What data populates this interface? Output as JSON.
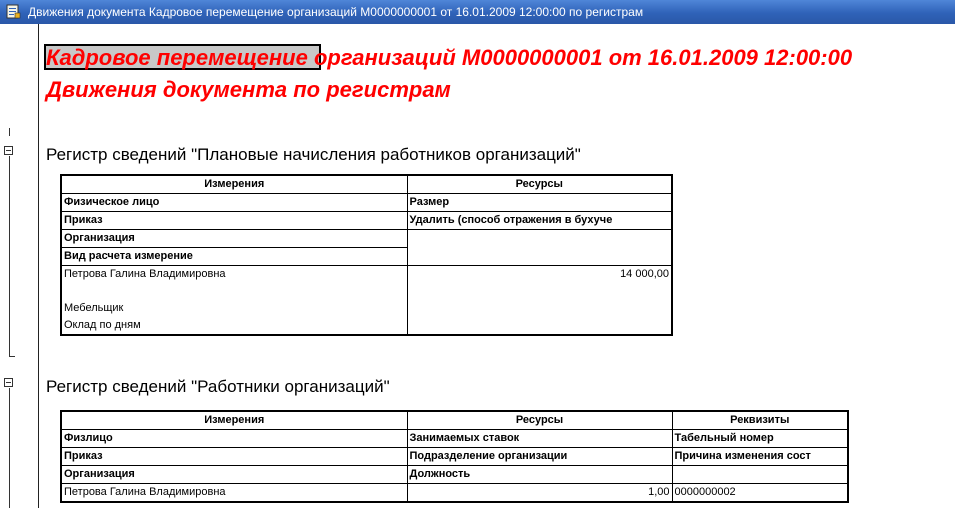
{
  "window": {
    "title": "Движения документа Кадровое перемещение организаций М0000000001 от 16.01.2009 12:00:00 по регистрам"
  },
  "header": {
    "line1": "Кадровое перемещение организаций М0000000001 от 16.01.2009 12:00:00",
    "line2": "Движения документа по регистрам"
  },
  "register1": {
    "title": "Регистр сведений \"Плановые начисления работников организаций\"",
    "col_dimensions": "Измерения",
    "col_resources": "Ресурсы",
    "dim_labels": [
      "Физическое лицо",
      "Приказ",
      "Организация",
      "Вид расчета измерение"
    ],
    "res_labels": [
      "Размер",
      "Удалить (способ отражения в бухуче",
      "",
      ""
    ],
    "row": {
      "dims": [
        "Петрова Галина Владимировна",
        "",
        "Мебельщик",
        "Оклад по дням"
      ],
      "amount": "14 000,00"
    }
  },
  "register2": {
    "title": "Регистр сведений \"Работники организаций\"",
    "col_dimensions": "Измерения",
    "col_resources": "Ресурсы",
    "col_props": "Реквизиты",
    "dim_labels": [
      "Физлицо",
      "Приказ",
      "Организация"
    ],
    "res_labels": [
      "Занимаемых ставок",
      "Подразделение организации",
      "Должность"
    ],
    "prop_labels": [
      "Табельный номер",
      "Причина изменения сост",
      ""
    ],
    "row": {
      "dim": "Петрова Галина Владимировна",
      "rate": "1,00",
      "tab_number": "0000000002"
    }
  }
}
